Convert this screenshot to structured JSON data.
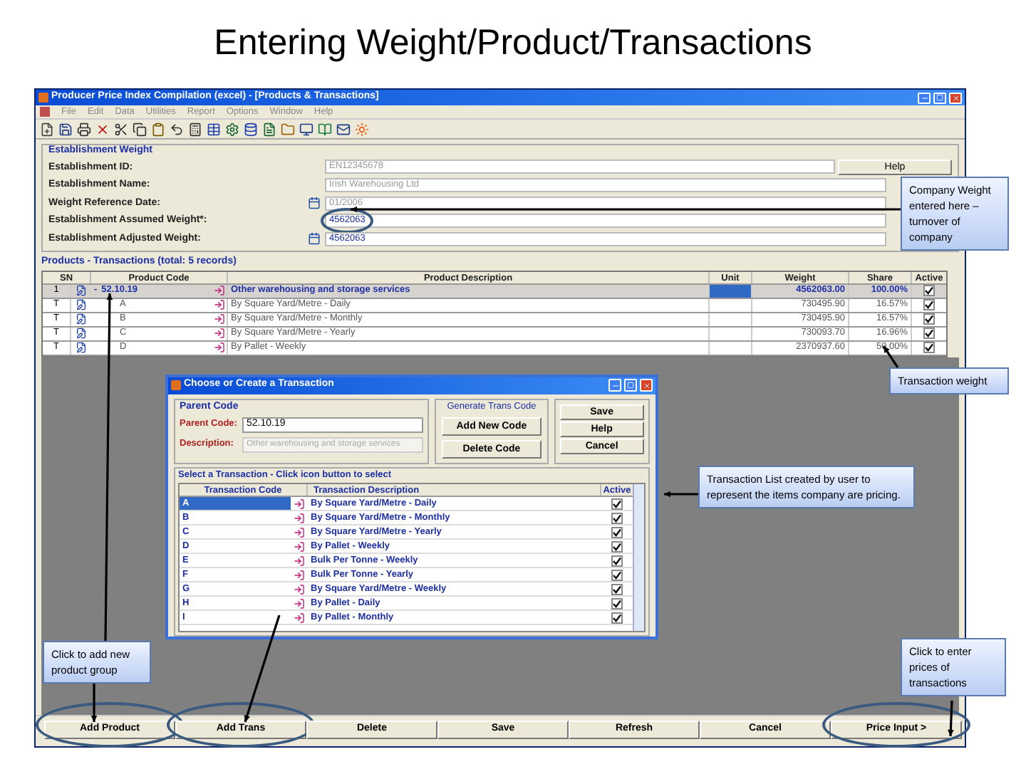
{
  "slide_title": "Entering Weight/Product/Transactions",
  "window": {
    "title": "Producer Price Index Compilation (excel) - [Products & Transactions]",
    "menu": [
      "File",
      "Edit",
      "Data",
      "Utilities",
      "Report",
      "Options",
      "Window",
      "Help"
    ],
    "establishment": {
      "title": "Establishment Weight",
      "help_button": "Help",
      "fields": [
        {
          "label": "Establishment ID:",
          "value": "EN12345678",
          "kind": "readonly",
          "circled": false
        },
        {
          "label": "Establishment Name:",
          "value": "Irish Warehousing Ltd",
          "kind": "readonly",
          "circled": false
        },
        {
          "label": "Weight Reference Date:",
          "value": "01/2006",
          "kind": "date",
          "circled": false
        },
        {
          "label": "Establishment Assumed Weight*:",
          "value": "4562063",
          "kind": "entry",
          "circled": true
        },
        {
          "label": "Establishment Adjusted Weight:",
          "value": "4562063",
          "kind": "computed",
          "circled": false
        }
      ]
    },
    "products": {
      "title": "Products - Transactions (total: 5 records)",
      "columns": [
        "SN",
        "Product Code",
        "Product Description",
        "Unit",
        "Weight",
        "Share",
        "Active"
      ],
      "rows": [
        {
          "sn": "1",
          "code": "52.10.19",
          "description": "Other warehousing and storage services",
          "weight": "4562063.00",
          "share": "100.00%",
          "active": true,
          "selected": true,
          "expanded": true,
          "toggle": "-",
          "children": [
            {
              "sn": "T",
              "code": "A",
              "description": "By Square Yard/Metre - Daily",
              "weight": "730495.90",
              "share": "16.57%",
              "active": true,
              "selected": false
            },
            {
              "sn": "T",
              "code": "B",
              "description": "By Square Yard/Metre - Monthly",
              "weight": "730495.90",
              "share": "16.57%",
              "active": true,
              "selected": false
            },
            {
              "sn": "T",
              "code": "C",
              "description": "By Square Yard/Metre - Yearly",
              "weight": "730093.70",
              "share": "16.96%",
              "active": true,
              "selected": false
            },
            {
              "sn": "T",
              "code": "D",
              "description": "By Pallet - Weekly",
              "weight": "2370937.60",
              "share": "50.00%",
              "active": true,
              "selected": false
            }
          ]
        }
      ]
    },
    "dialog": {
      "title": "Choose or Create a Transaction",
      "parent_group": "Parent Code",
      "parent_label": "Parent Code:",
      "parent_value": "52.10.19",
      "description_label": "Description:",
      "description_value": "Other warehousing and storage services",
      "generate_group": "Generate Trans Code",
      "generate_buttons": [
        "Add New Code",
        "Delete Code"
      ],
      "side_buttons": [
        "Save",
        "Help",
        "Cancel"
      ],
      "list_title": "Select a Transaction - Click icon button to select",
      "columns": [
        "Transaction Code",
        "Transaction Description",
        "Active"
      ],
      "rows": [
        {
          "code": "A",
          "description": "By Square Yard/Metre - Daily",
          "active": true,
          "selected": true
        },
        {
          "code": "B",
          "description": "By Square Yard/Metre - Monthly",
          "active": true,
          "selected": false
        },
        {
          "code": "C",
          "description": "By Square Yard/Metre - Yearly",
          "active": true,
          "selected": false
        },
        {
          "code": "D",
          "description": "By Pallet - Weekly",
          "active": true,
          "selected": false
        },
        {
          "code": "E",
          "description": "Bulk Per Tonne - Weekly",
          "active": true,
          "selected": false
        },
        {
          "code": "F",
          "description": "Bulk Per Tonne - Yearly",
          "active": true,
          "selected": false
        },
        {
          "code": "G",
          "description": "By Square Yard/Metre - Weekly",
          "active": true,
          "selected": false
        },
        {
          "code": "H",
          "description": "By Pallet - Daily",
          "active": true,
          "selected": false
        },
        {
          "code": "I",
          "description": "By Pallet - Monthly",
          "active": true,
          "selected": false
        }
      ]
    },
    "buttons": [
      {
        "label": "Add Product",
        "circled": true
      },
      {
        "label": "Add Trans",
        "circled": true
      },
      {
        "label": "Delete",
        "circled": false
      },
      {
        "label": "Save",
        "circled": false
      },
      {
        "label": "Refresh",
        "circled": false
      },
      {
        "label": "Cancel",
        "circled": false
      },
      {
        "label": "Price Input >",
        "circled": true
      }
    ]
  },
  "callouts": [
    {
      "text": "Company Weight entered here – turnover of company"
    },
    {
      "text": "Transaction weight"
    },
    {
      "text": "Transaction List created by user to represent the items company are pricing."
    },
    {
      "text": "Click to add new product group"
    },
    {
      "text": "Click to enter prices of transactions"
    }
  ]
}
